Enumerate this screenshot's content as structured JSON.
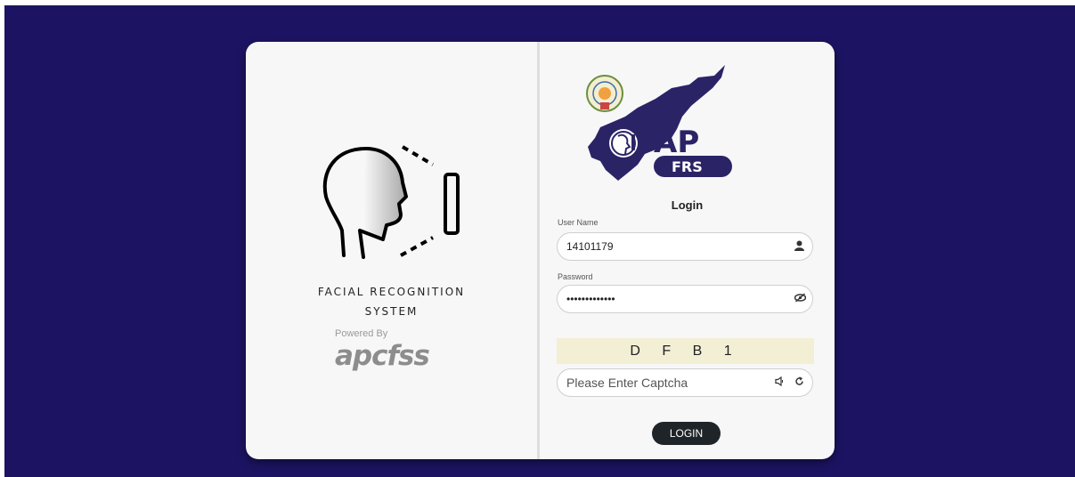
{
  "left_panel": {
    "tagline_line1": "FACIAL RECOGNITION",
    "tagline_line2": "SYSTEM",
    "powered_by": "Powered By",
    "powered_logo_text": "apcfss"
  },
  "right_panel": {
    "logo_text_ap": "AP",
    "logo_text_frs": "FRS",
    "title": "Login",
    "username": {
      "label": "User Name",
      "value": "14101179",
      "icon": "user-icon"
    },
    "password": {
      "label": "Password",
      "value": "•••••••••••••",
      "icon": "eye-slash-icon"
    },
    "captcha": {
      "code": "D F B 1",
      "placeholder": "Please Enter Captcha",
      "audio_icon": "speaker-icon",
      "refresh_icon": "refresh-icon"
    },
    "login_button": "LOGIN"
  },
  "colors": {
    "background": "#1c1463",
    "map": "#2a2466",
    "captcha_bg": "#f3efd5",
    "button": "#1f2429"
  }
}
